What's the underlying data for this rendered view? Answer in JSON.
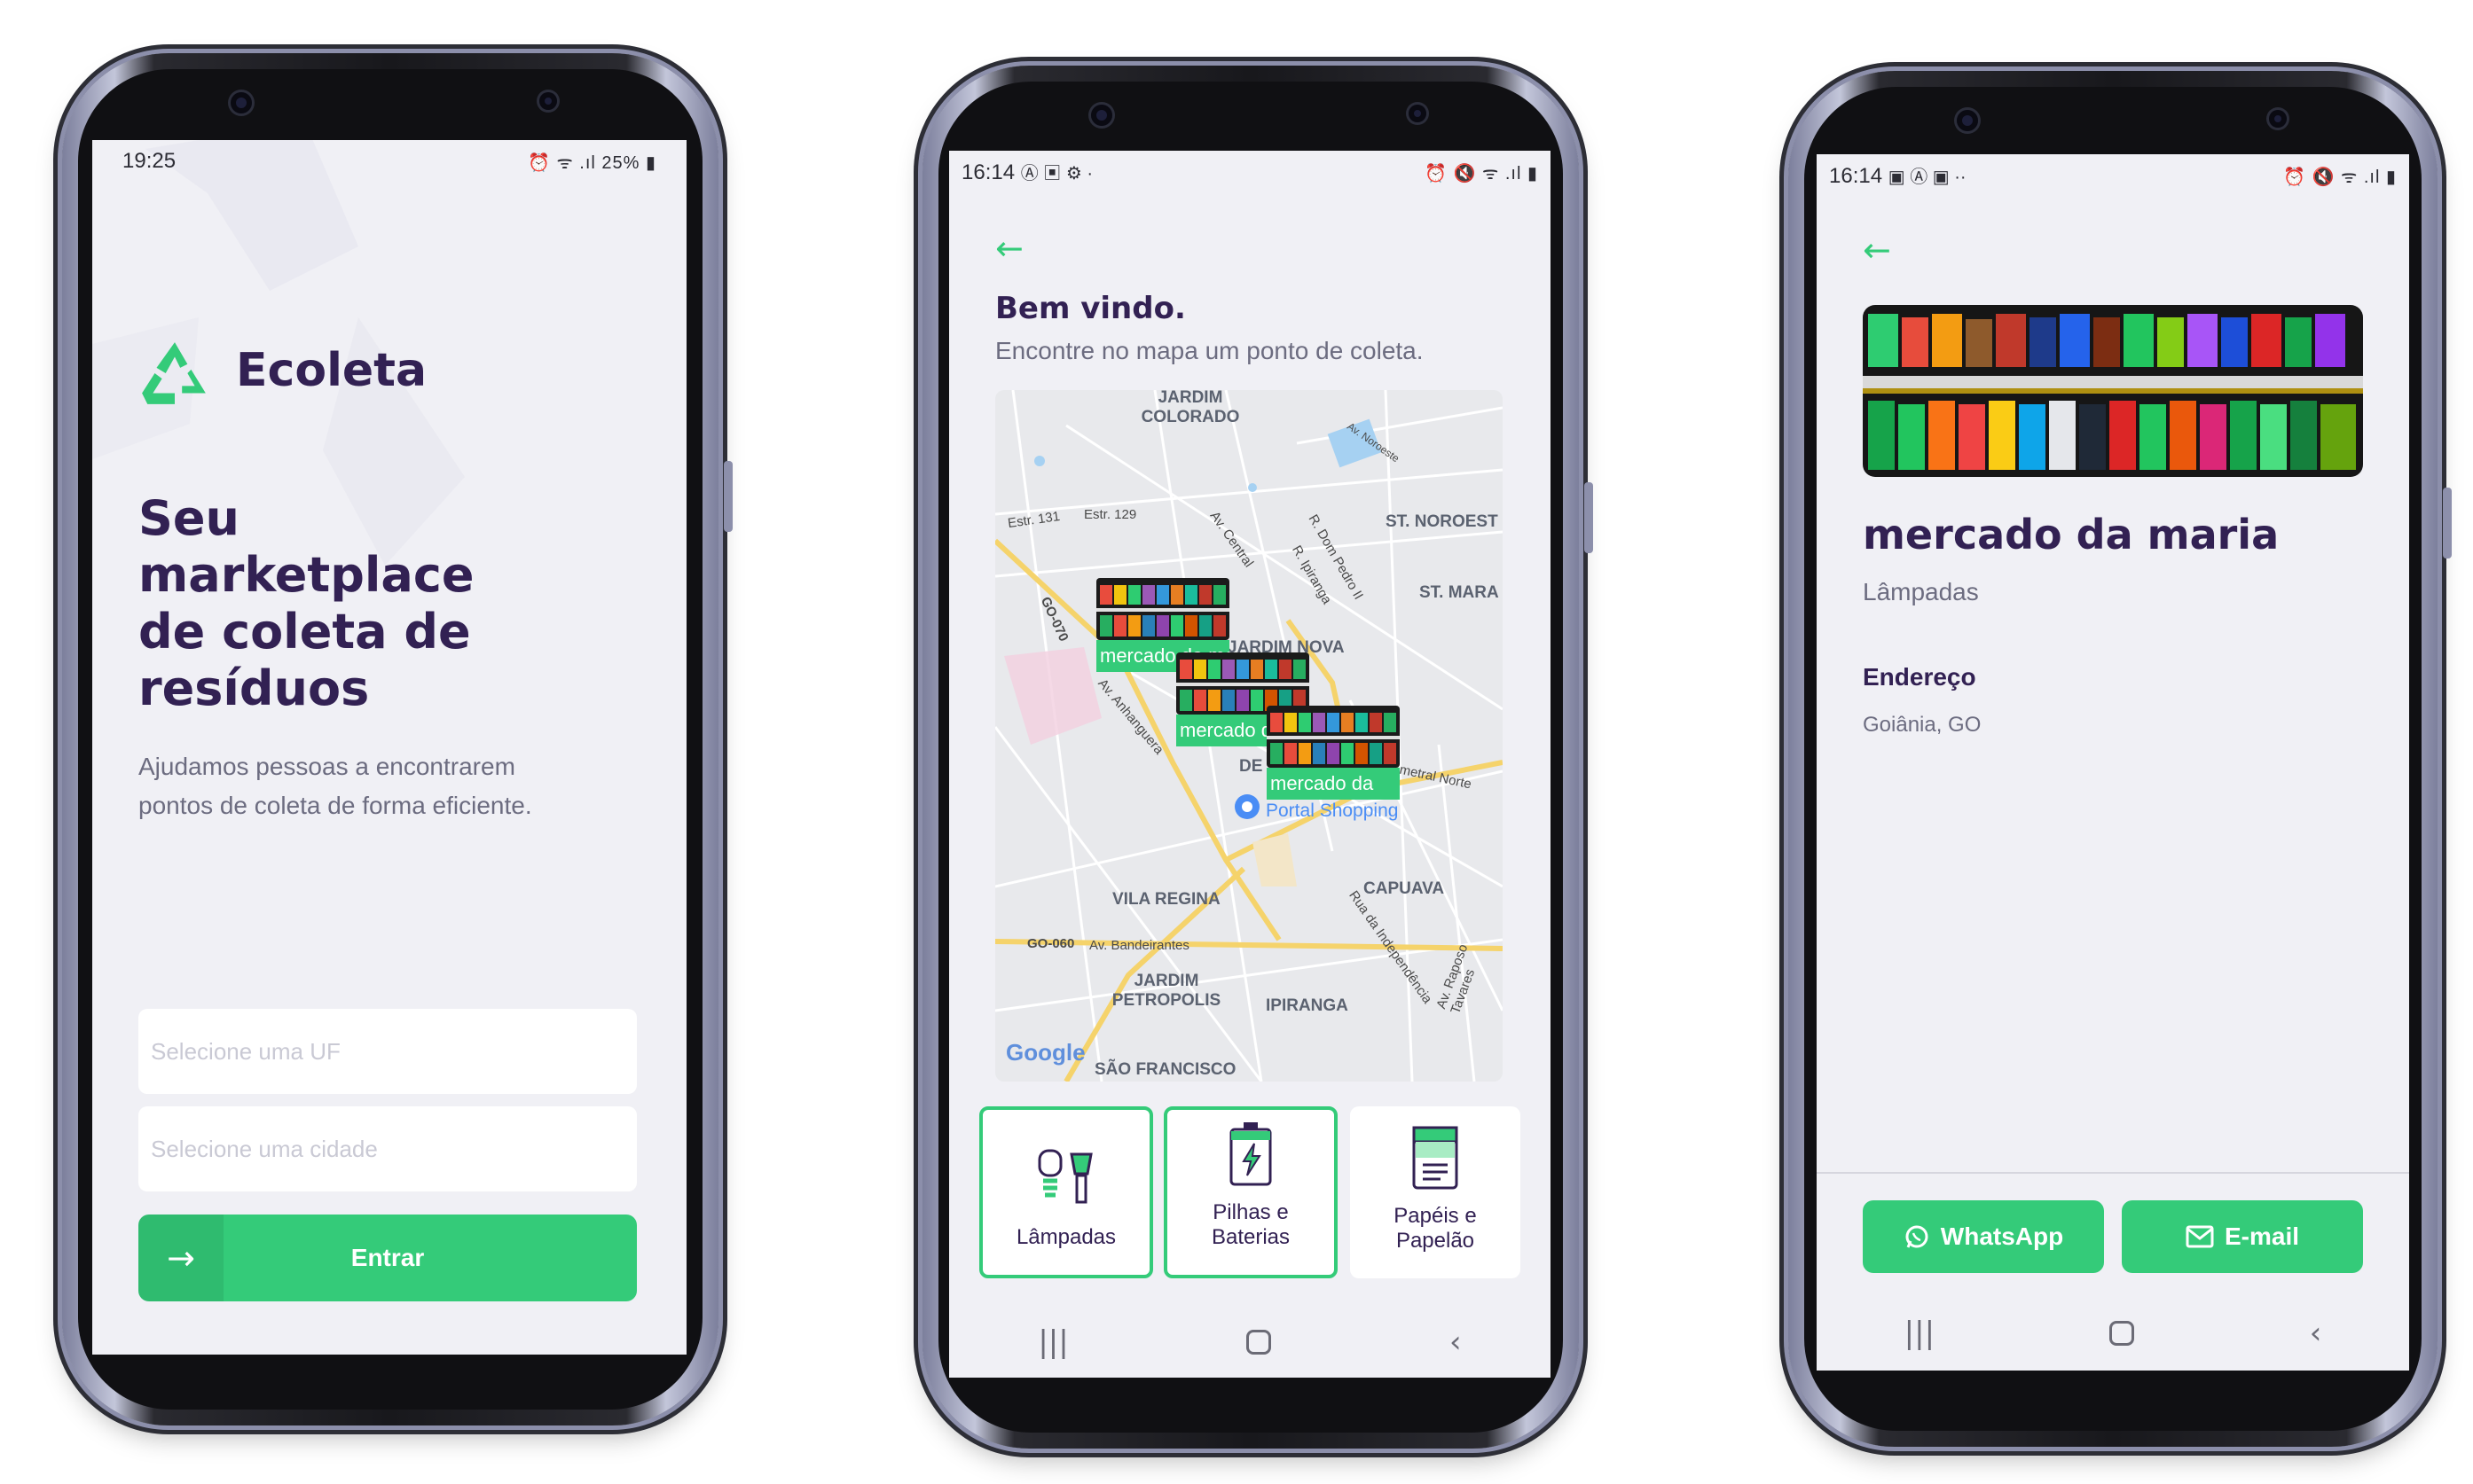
{
  "colors": {
    "brand": "#34cb79",
    "title": "#322153",
    "text": "#6c6c80",
    "background": "#f0f0f5"
  },
  "screen1": {
    "status": {
      "time": "19:25",
      "icons": "⏰ ᯤ .ıl 25% ▮"
    },
    "logo": {
      "icon": "recycle-icon",
      "name": "Ecoleta"
    },
    "headline": "Seu marketplace de coleta de resíduos",
    "description": "Ajudamos pessoas a encontrarem pontos de coleta de forma eficiente.",
    "uf_placeholder": "Selecione uma UF",
    "city_placeholder": "Selecione uma cidade",
    "enter_label": "Entrar"
  },
  "screen2": {
    "status": {
      "time": "16:14",
      "left_icons": "Ⓐ ▣ ⚙ ·",
      "icons": "⏰ 🔇 ᯤ .ıl ▮"
    },
    "welcome": "Bem vindo.",
    "subtitle": "Encontre no mapa um ponto de coleta.",
    "map": {
      "labels": [
        "JARDIM COLORADO",
        "ST. NOROEST",
        "ST. MARA",
        "JARDIM NOVA",
        "DE",
        "Portal Shopping",
        "CAPUAVA",
        "VILA REGINA",
        "JARDIM PETROPOLIS",
        "IPIRANGA",
        "SÃO FRANCISCO"
      ],
      "roads": [
        "Estr. 131",
        "Estr. 129",
        "GO-070",
        "Av. Anhanguera",
        "Av. Central",
        "R. Dom Pedro II",
        "R. Ipiranga",
        "GO-060",
        "Av. Bandeirantes",
        "Rua da Independência",
        "Av. Raposo Tavares",
        "Av. Noroeste",
        "metral Norte"
      ],
      "markers": [
        "mercado da maria",
        "mercado da maria",
        "mercado da"
      ],
      "google": "Google"
    },
    "categories": [
      {
        "label": "Lâmpadas",
        "icon": "lamp-icon",
        "selected": true
      },
      {
        "label": "Pilhas e Baterias",
        "icon": "battery-icon",
        "selected": true
      },
      {
        "label": "Papéis e Papelão",
        "icon": "paper-icon",
        "selected": false
      }
    ]
  },
  "screen3": {
    "status": {
      "time": "16:14",
      "left_icons": "▣ Ⓐ ▣ ··",
      "icons": "⏰ 🔇 ᯤ .ıl ▮"
    },
    "name": "mercado da maria",
    "items": "Lâmpadas",
    "address_title": "Endereço",
    "address": "Goiânia, GO",
    "whatsapp_label": "WhatsApp",
    "email_label": "E-mail"
  }
}
